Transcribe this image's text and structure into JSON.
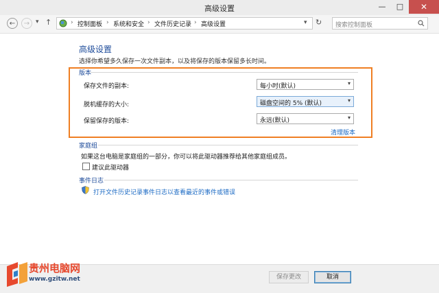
{
  "window": {
    "title": "高级设置",
    "min": "—",
    "max": "□",
    "close": "✕"
  },
  "nav": {
    "back": "←",
    "forward": "→",
    "dropdown": "▾",
    "up": "↑",
    "breadcrumbs": [
      "控制面板",
      "系统和安全",
      "文件历史记录",
      "高级设置"
    ],
    "separator": "›",
    "address_dropdown": "▾",
    "refresh": "↻",
    "search_placeholder": "搜索控制面板"
  },
  "page": {
    "heading": "高级设置",
    "description": "选择你希望多久保存一次文件副本，以及将保存的版本保留多长时间。"
  },
  "versions": {
    "label": "版本",
    "rows": [
      {
        "label": "保存文件的副本:",
        "value": "每小时(默认)"
      },
      {
        "label": "脱机缓存的大小:",
        "value": "磁盘空间的 5% (默认)"
      },
      {
        "label": "保留保存的版本:",
        "value": "永远(默认)"
      }
    ],
    "cleanup_link": "清理版本"
  },
  "homegroup": {
    "label": "家庭组",
    "text": "如果这台电脑是家庭组的一部分，你可以将此驱动器推荐给其他家庭组成员。",
    "checkbox_label": "建议此驱动器",
    "checked": false
  },
  "eventlog": {
    "label": "事件日志",
    "link": "打开文件历史记录事件日志以查看最近的事件或错误"
  },
  "buttons": {
    "save": "保存更改",
    "cancel": "取消"
  },
  "watermark": {
    "name": "贵州电脑网",
    "url": "www.gzitw.net"
  },
  "colors": {
    "accent_blue": "#1d4b9a",
    "link_blue": "#1d6bc4",
    "highlight_orange": "#ef7e22",
    "close_red": "#c7504e"
  }
}
